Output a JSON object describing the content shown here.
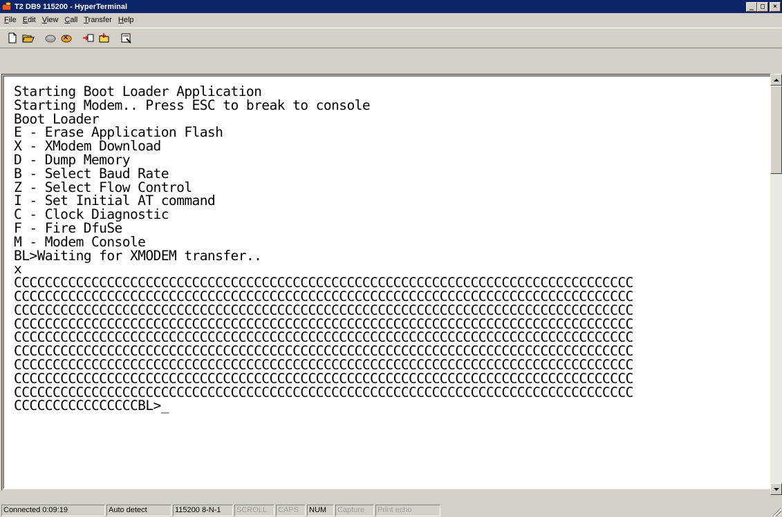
{
  "window": {
    "title": "T2 DB9 115200 - HyperTerminal"
  },
  "menu": {
    "items": [
      {
        "label": "File",
        "accel": "F",
        "rest": "ile"
      },
      {
        "label": "Edit",
        "accel": "E",
        "rest": "dit"
      },
      {
        "label": "View",
        "accel": "V",
        "rest": "iew"
      },
      {
        "label": "Call",
        "accel": "C",
        "rest": "all"
      },
      {
        "label": "Transfer",
        "accel": "T",
        "rest": "ransfer"
      },
      {
        "label": "Help",
        "accel": "H",
        "rest": "elp"
      }
    ]
  },
  "toolbar": {
    "buttons": [
      {
        "name": "new-connection-icon"
      },
      {
        "name": "open-icon"
      },
      {
        "name": "connect-icon"
      },
      {
        "name": "disconnect-icon"
      },
      {
        "name": "send-icon"
      },
      {
        "name": "receive-icon"
      },
      {
        "name": "properties-icon"
      }
    ]
  },
  "terminal": {
    "text": "Starting Boot Loader Application\nStarting Modem.. Press ESC to break to console\nBoot Loader\nE - Erase Application Flash\nX - XModem Download\nD - Dump Memory\nB - Select Baud Rate\nZ - Select Flow Control\nI - Set Initial AT command\nC - Clock Diagnostic\nF - Fire DfuSe\nM - Modem Console\nBL>Waiting for XMODEM transfer..\nx\nCCCCCCCCCCCCCCCCCCCCCCCCCCCCCCCCCCCCCCCCCCCCCCCCCCCCCCCCCCCCCCCCCCCCCCCCCCCCCCCC\nCCCCCCCCCCCCCCCCCCCCCCCCCCCCCCCCCCCCCCCCCCCCCCCCCCCCCCCCCCCCCCCCCCCCCCCCCCCCCCCC\nCCCCCCCCCCCCCCCCCCCCCCCCCCCCCCCCCCCCCCCCCCCCCCCCCCCCCCCCCCCCCCCCCCCCCCCCCCCCCCCC\nCCCCCCCCCCCCCCCCCCCCCCCCCCCCCCCCCCCCCCCCCCCCCCCCCCCCCCCCCCCCCCCCCCCCCCCCCCCCCCCC\nCCCCCCCCCCCCCCCCCCCCCCCCCCCCCCCCCCCCCCCCCCCCCCCCCCCCCCCCCCCCCCCCCCCCCCCCCCCCCCCC\nCCCCCCCCCCCCCCCCCCCCCCCCCCCCCCCCCCCCCCCCCCCCCCCCCCCCCCCCCCCCCCCCCCCCCCCCCCCCCCCC\nCCCCCCCCCCCCCCCCCCCCCCCCCCCCCCCCCCCCCCCCCCCCCCCCCCCCCCCCCCCCCCCCCCCCCCCCCCCCCCCC\nCCCCCCCCCCCCCCCCCCCCCCCCCCCCCCCCCCCCCCCCCCCCCCCCCCCCCCCCCCCCCCCCCCCCCCCCCCCCCCCC\nCCCCCCCCCCCCCCCCCCCCCCCCCCCCCCCCCCCCCCCCCCCCCCCCCCCCCCCCCCCCCCCCCCCCCCCCCCCCCCCC\nCCCCCCCCCCCCCCCCBL>_"
  },
  "statusbar": {
    "connected": "Connected 0:09:19",
    "detect": "Auto detect",
    "settings": "115200 8-N-1",
    "scroll": "SCROLL",
    "caps": "CAPS",
    "num": "NUM",
    "capture": "Capture",
    "print_echo": "Print echo"
  },
  "colors": {
    "titlebar": "#0a246a",
    "face": "#d4d0c8",
    "terminal_bg": "#ffffff"
  }
}
